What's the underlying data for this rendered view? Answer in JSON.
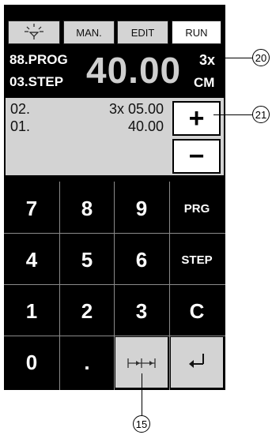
{
  "modebar": {
    "light_icon": "light-bulb-icon",
    "man_label": "MAN.",
    "edit_label": "EDIT",
    "run_label": "RUN"
  },
  "display": {
    "program": "88.PROG",
    "step": "03.STEP",
    "value": "40.00",
    "multiplier": "3x",
    "unit": "CM"
  },
  "list": {
    "rows": [
      {
        "index": "02.",
        "value": "3x 05.00"
      },
      {
        "index": "01.",
        "value": "40.00"
      }
    ],
    "plus_label": "+",
    "minus_label": "−"
  },
  "keypad": {
    "k7": "7",
    "k8": "8",
    "k9": "9",
    "prg": "PRG",
    "k4": "4",
    "k5": "5",
    "k6": "6",
    "step": "STEP",
    "k1": "1",
    "k2": "2",
    "k3": "3",
    "clear": "C",
    "k0": "0",
    "dot": ".",
    "split_icon": "split-dimension-icon",
    "enter_icon": "enter-return-icon"
  },
  "callouts": {
    "c20": "20",
    "c21": "21",
    "c15": "15"
  }
}
